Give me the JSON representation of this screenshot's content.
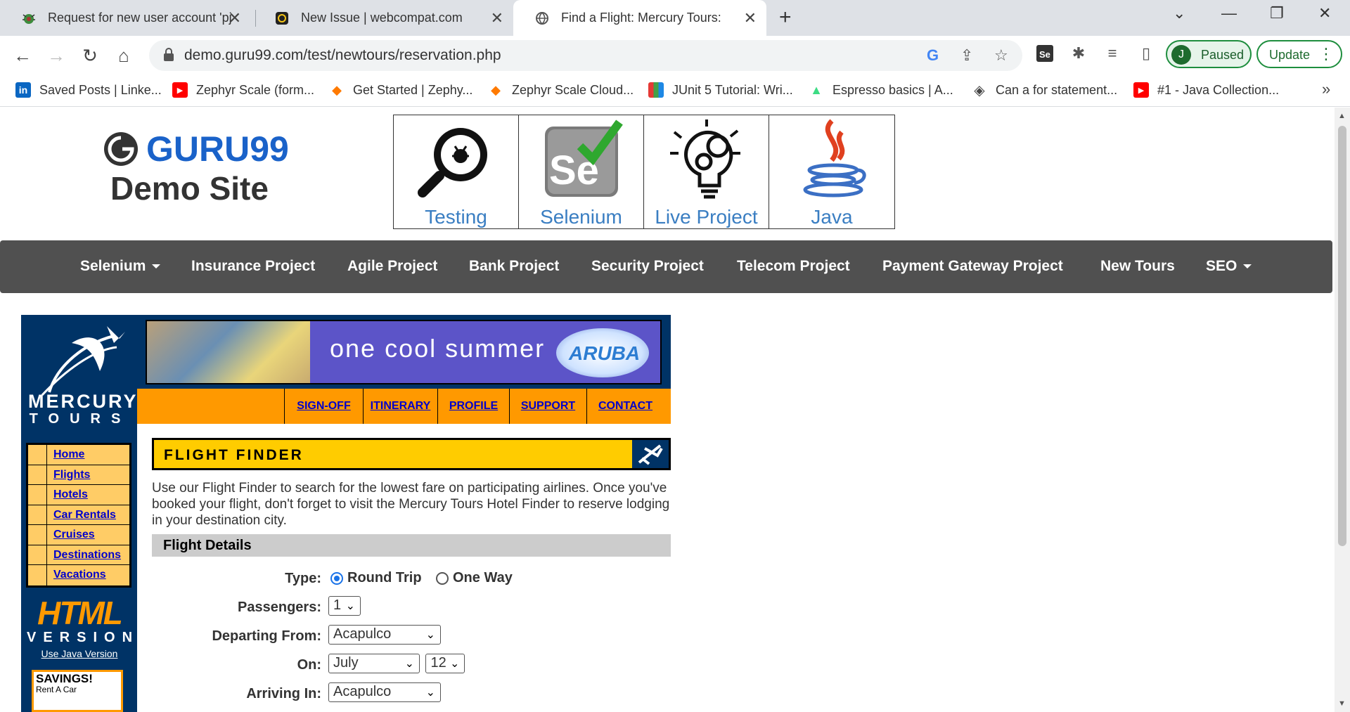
{
  "browser": {
    "tabs": [
      {
        "title": "Request for new user account 'pj",
        "close": "✕"
      },
      {
        "title": "New Issue | webcompat.com",
        "close": "✕"
      },
      {
        "title": "Find a Flight: Mercury Tours:",
        "close": "✕"
      }
    ],
    "url": "demo.guru99.com/test/newtours/reservation.php",
    "profile_initial": "J",
    "profile_status": "Paused",
    "update_label": "Update",
    "bookmarks": [
      {
        "label": "Saved Posts | Linke...",
        "icon": "linkedin-icon",
        "color": "#0a66c2"
      },
      {
        "label": "Zephyr Scale (form...",
        "icon": "youtube-icon",
        "color": "#ff0000"
      },
      {
        "label": "Get Started | Zephy...",
        "icon": "zephyr-icon",
        "color": "#ff7a00"
      },
      {
        "label": "Zephyr Scale Cloud...",
        "icon": "zephyr-icon",
        "color": "#ff7a00"
      },
      {
        "label": "JUnit 5 Tutorial: Wri...",
        "icon": "grid-icon",
        "color": "#a43cc4"
      },
      {
        "label": "Espresso basics  |  A...",
        "icon": "android-icon",
        "color": "#3ddc84"
      },
      {
        "label": "Can a for statement...",
        "icon": "diamond-icon",
        "color": "#444444"
      },
      {
        "label": "#1 - Java Collection...",
        "icon": "youtube-icon",
        "color": "#ff0000"
      }
    ]
  },
  "site": {
    "logo_text": "GURU99",
    "logo_sub": "Demo Site",
    "top_cells": [
      {
        "label": "Testing"
      },
      {
        "label": "Selenium"
      },
      {
        "label": "Live Project"
      },
      {
        "label": "Java"
      }
    ],
    "menu": [
      {
        "label": "Selenium",
        "dropdown": true
      },
      {
        "label": "Insurance Project"
      },
      {
        "label": "Agile Project"
      },
      {
        "label": "Bank Project"
      },
      {
        "label": "Security Project"
      },
      {
        "label": "Telecom Project"
      },
      {
        "label": "Payment Gateway Project"
      },
      {
        "label": "New Tours"
      },
      {
        "label": "SEO",
        "dropdown": true
      }
    ]
  },
  "mercury": {
    "logo_line1": "MERCURY",
    "logo_line2": "TOURS",
    "banner_text": "one cool summer",
    "banner_brand": "ARUBA",
    "top_links": [
      "SIGN-OFF",
      "ITINERARY",
      "PROFILE",
      "SUPPORT",
      "CONTACT"
    ],
    "left_nav": [
      "Home",
      "Flights",
      "Hotels",
      "Car Rentals",
      "Cruises",
      "Destinations",
      "Vacations"
    ],
    "html_version": "HTML",
    "html_version_sub": "VERSION",
    "java_version_link": "Use Java Version",
    "savings_title": "SAVINGS!",
    "savings_sub": "Rent A Car",
    "finder_title": "FLIGHT FINDER",
    "intro": "Use our Flight Finder to search for the lowest fare on participating airlines. Once you've booked your flight, don't forget to visit the Mercury Tours Hotel Finder to reserve lodging in your destination city.",
    "section_title": "Flight Details",
    "form": {
      "type_label": "Type:",
      "type_options": [
        "Round Trip",
        "One Way"
      ],
      "type_selected": "Round Trip",
      "passengers_label": "Passengers:",
      "passengers_value": "1",
      "departing_label": "Departing From:",
      "departing_value": "Acapulco",
      "on_label": "On:",
      "on_month": "July",
      "on_day": "12",
      "arriving_label": "Arriving In:",
      "arriving_value": "Acapulco"
    }
  },
  "colors": {
    "mercury_navy": "#003366",
    "mercury_orange": "#ff9900",
    "finder_yellow": "#ffcc00",
    "guru_blue": "#1a62c9",
    "menubar_gray": "#505050"
  }
}
